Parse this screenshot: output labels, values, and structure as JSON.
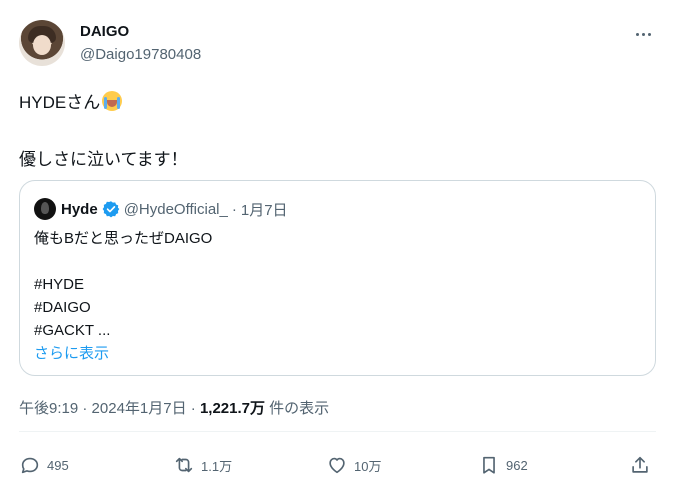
{
  "author": {
    "display_name": "DAIGO",
    "handle": "@Daigo19780408",
    "avatar_icon": "profile-photo"
  },
  "tweet": {
    "line1": "HYDEさん",
    "line1_emoji": "loudly-crying-face",
    "line2": "優しさに泣いてます！"
  },
  "quote": {
    "name": "Hyde",
    "verified_icon": "verified-badge-icon",
    "handle": "@HydeOfficial_",
    "separator": "·",
    "date": "1月7日",
    "text": "俺もBだと思ったぜDAIGO\n\n#HYDE\n#DAIGO\n#GACKT ...",
    "show_more": "さらに表示"
  },
  "meta": {
    "time": "午後9:19",
    "dot1": "·",
    "date": "2024年1月7日",
    "dot2": "·",
    "views_count": "1,221.7万",
    "views_label": "件の表示"
  },
  "actions": {
    "reply_count": "495",
    "retweet_count": "1.1万",
    "like_count": "10万",
    "bookmark_count": "962"
  },
  "colors": {
    "text_primary": "#0f1419",
    "text_secondary": "#536471",
    "link": "#1d9bf0",
    "border": "#cfd9de"
  }
}
